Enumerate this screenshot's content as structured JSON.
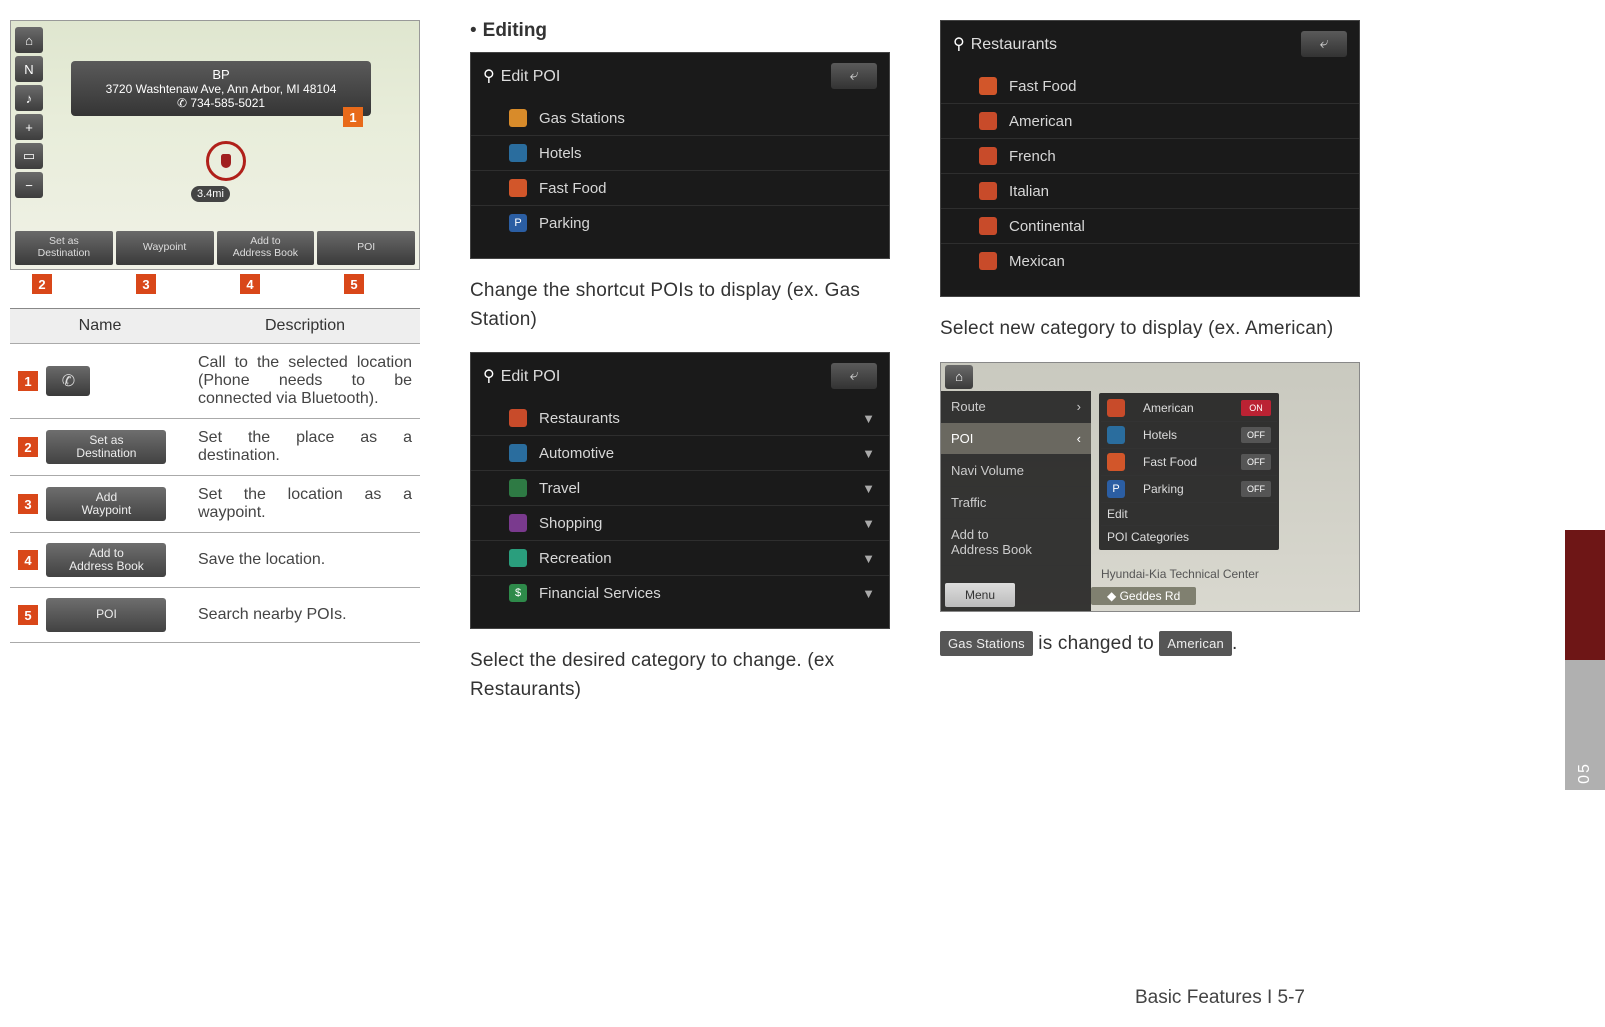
{
  "col1": {
    "map": {
      "address_name": "BP",
      "address_line": "3720 Washtenaw Ave, Ann Arbor, MI 48104",
      "phone": "✆ 734-585-5021",
      "distance": "3.4mi",
      "side_buttons": [
        "⌂",
        "N",
        "♪",
        "+",
        "▭",
        "−"
      ],
      "bottom_buttons": [
        "Set as\nDestination",
        "Waypoint",
        "Add to\nAddress Book",
        "POI"
      ],
      "callouts_top": "1",
      "callouts_bottom": [
        "2",
        "3",
        "4",
        "5"
      ]
    },
    "table": {
      "head_name": "Name",
      "head_desc": "Description",
      "rows": [
        {
          "num": "1",
          "chip": "",
          "chip_type": "phone",
          "desc": "Call to the selected location (Phone needs to be connected via Bluetooth)."
        },
        {
          "num": "2",
          "chip": "Set as\nDestination",
          "desc": "Set the place as a destination."
        },
        {
          "num": "3",
          "chip": "Add\nWaypoint",
          "desc": "Set the location as a waypoint."
        },
        {
          "num": "4",
          "chip": "Add to\nAddress Book",
          "desc": "Save the location."
        },
        {
          "num": "5",
          "chip": "POI",
          "desc": "Search nearby POIs."
        }
      ]
    }
  },
  "col2": {
    "heading": "Editing",
    "shot1": {
      "title": "Edit POI",
      "items": [
        {
          "color": "#d88b2a",
          "label": "Gas Stations"
        },
        {
          "color": "#2a6d9e",
          "label": "Hotels"
        },
        {
          "color": "#d2562a",
          "label": "Fast Food"
        },
        {
          "color": "#2b5ea3",
          "glyph": "P",
          "label": "Parking"
        }
      ]
    },
    "caption1": "Change the shortcut POIs to display (ex. Gas Station)",
    "shot2": {
      "title": "Edit POI",
      "items": [
        {
          "color": "#c84b2a",
          "label": "Restaurants"
        },
        {
          "color": "#2a6d9e",
          "label": "Automotive"
        },
        {
          "color": "#2e7a44",
          "label": "Travel"
        },
        {
          "color": "#7a3a8e",
          "label": "Shopping"
        },
        {
          "color": "#2a9e7d",
          "label": "Recreation"
        },
        {
          "color": "#2e8a4a",
          "glyph": "$",
          "label": "Financial Services"
        }
      ]
    },
    "caption2": "Select the desired category to change. (ex Restaurants)"
  },
  "col3": {
    "shot1": {
      "title": "Restaurants",
      "items": [
        {
          "color": "#d2562a",
          "label": "Fast Food"
        },
        {
          "color": "#c84b2a",
          "label": "American"
        },
        {
          "color": "#c84b2a",
          "label": "French"
        },
        {
          "color": "#c84b2a",
          "label": "Italian"
        },
        {
          "color": "#c84b2a",
          "label": "Continental"
        },
        {
          "color": "#c84b2a",
          "label": "Mexican"
        }
      ]
    },
    "caption1": "Select new category to display (ex. American)",
    "nav": {
      "left_items": [
        {
          "label": "Route",
          "arrow": "›"
        },
        {
          "label": "POI",
          "arrow": "‹",
          "sel": true
        },
        {
          "label": "Navi Volume"
        },
        {
          "label": "Traffic"
        },
        {
          "label": "Add to\nAddress Book"
        }
      ],
      "popup": [
        {
          "color": "#c84b2a",
          "label": "American",
          "toggle": "ON"
        },
        {
          "color": "#2a6d9e",
          "label": "Hotels",
          "toggle": "OFF"
        },
        {
          "color": "#d2562a",
          "label": "Fast Food",
          "toggle": "OFF"
        },
        {
          "color": "#2b5ea3",
          "glyph": "P",
          "label": "Parking",
          "toggle": "OFF"
        },
        {
          "plain": true,
          "label": "Edit"
        },
        {
          "plain": true,
          "label": "POI Categories"
        }
      ],
      "menu": "Menu",
      "road": "Geddes Rd",
      "center": "Hyundai-Kia Technical Center"
    },
    "result_line": {
      "a": "Gas Stations",
      "mid": " is changed to ",
      "b": "American",
      "end": "."
    }
  },
  "page_tab": "05",
  "footer": "Basic Features I 5-7"
}
